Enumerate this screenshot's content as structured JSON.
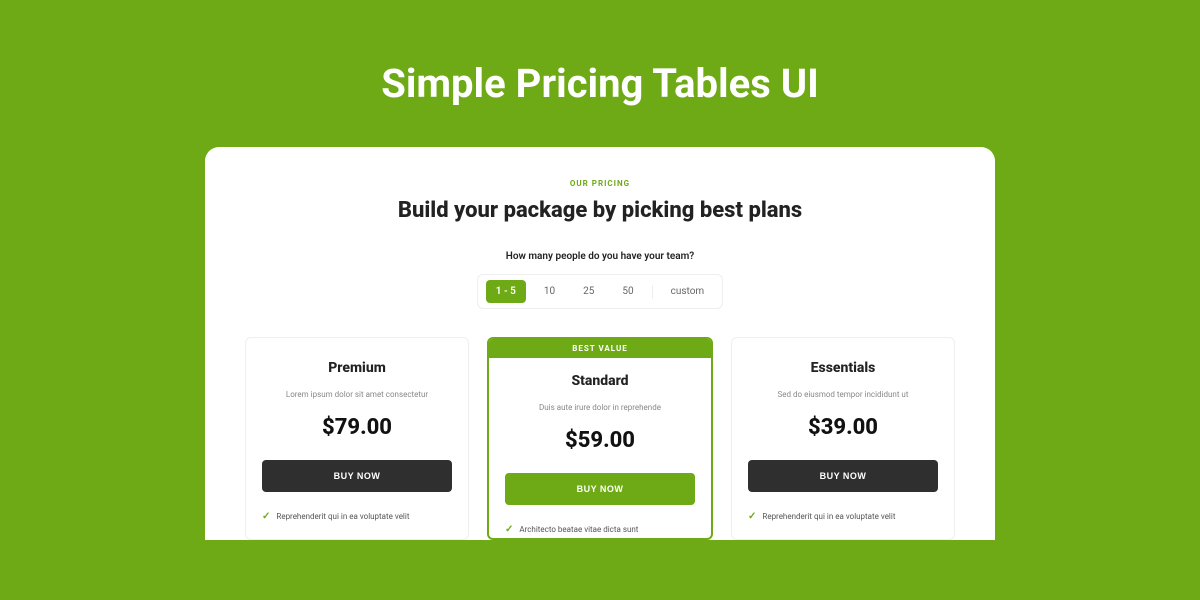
{
  "hero": {
    "title": "Simple Pricing Tables UI"
  },
  "eyebrow": "OUR PRICING",
  "heading": "Build your package by picking best plans",
  "question": "How many people do you have your team?",
  "segmented": {
    "options": [
      "1 - 5",
      "10",
      "25",
      "50",
      "custom"
    ],
    "active_index": 0
  },
  "best_value_label": "BEST VALUE",
  "buy_label": "BUY NOW",
  "plans": [
    {
      "name": "Premium",
      "desc": "Lorem ipsum dolor sit amet consectetur",
      "price": "$79.00",
      "featured": false,
      "features": [
        "Reprehenderit qui in ea voluptate velit"
      ]
    },
    {
      "name": "Standard",
      "desc": "Duis aute irure dolor in reprehende",
      "price": "$59.00",
      "featured": true,
      "features": [
        "Architecto beatae vitae dicta sunt"
      ]
    },
    {
      "name": "Essentials",
      "desc": "Sed do eiusmod tempor incididunt ut",
      "price": "$39.00",
      "featured": false,
      "features": [
        "Reprehenderit qui in ea voluptate velit"
      ]
    }
  ]
}
